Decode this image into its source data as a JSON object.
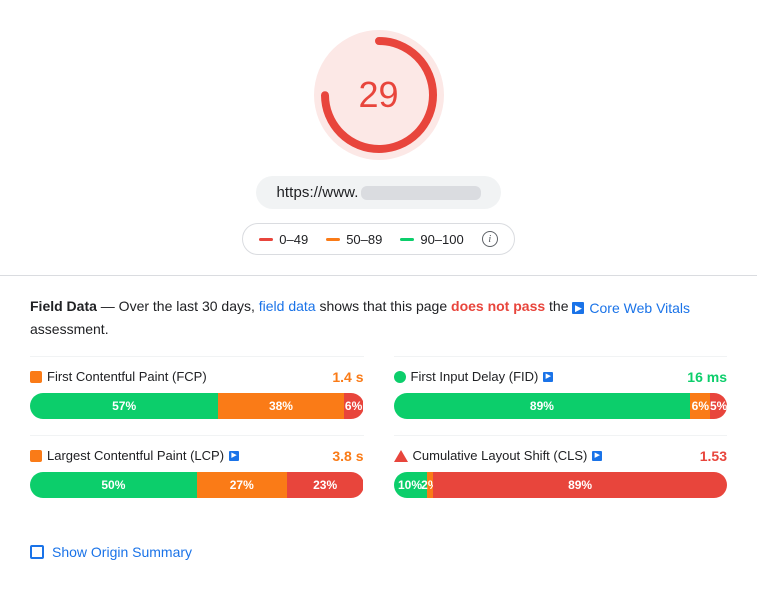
{
  "score": {
    "value": "29",
    "color": "#e8453c",
    "bg_color": "#fce8e6",
    "arc_percent": 29
  },
  "url": {
    "display": "https://www."
  },
  "legend": {
    "range1": "0–49",
    "range2": "50–89",
    "range3": "90–100"
  },
  "field_data": {
    "label": "Field Data",
    "description_prefix": "— Over the last 30 days,",
    "link_text": "field data",
    "description_mid": "shows that this page",
    "fail_text": "does not pass",
    "description_suffix": "the",
    "cwv_text": "Core Web Vitals",
    "assessment": "assessment."
  },
  "metrics": [
    {
      "id": "fcp",
      "icon_type": "orange-square",
      "title": "First Contentful Paint (FCP)",
      "has_flag": false,
      "value": "1.4 s",
      "value_color": "orange",
      "bars": [
        {
          "label": "57%",
          "pct": 57,
          "color": "green"
        },
        {
          "label": "38%",
          "pct": 38,
          "color": "orange"
        },
        {
          "label": "6%",
          "pct": 6,
          "color": "red"
        }
      ]
    },
    {
      "id": "fid",
      "icon_type": "green-circle",
      "title": "First Input Delay (FID)",
      "has_flag": true,
      "value": "16 ms",
      "value_color": "green",
      "bars": [
        {
          "label": "89%",
          "pct": 89,
          "color": "green"
        },
        {
          "label": "6%",
          "pct": 6,
          "color": "orange"
        },
        {
          "label": "5%",
          "pct": 5,
          "color": "red"
        }
      ]
    },
    {
      "id": "lcp",
      "icon_type": "orange-square",
      "title": "Largest Contentful Paint (LCP)",
      "has_flag": true,
      "value": "3.8 s",
      "value_color": "orange",
      "bars": [
        {
          "label": "50%",
          "pct": 50,
          "color": "green"
        },
        {
          "label": "27%",
          "pct": 27,
          "color": "orange"
        },
        {
          "label": "23%",
          "pct": 23,
          "color": "red"
        }
      ]
    },
    {
      "id": "cls",
      "icon_type": "red-triangle",
      "title": "Cumulative Layout Shift (CLS)",
      "has_flag": true,
      "value": "1.53",
      "value_color": "red",
      "bars": [
        {
          "label": "10%",
          "pct": 10,
          "color": "green"
        },
        {
          "label": "2%",
          "pct": 2,
          "color": "orange"
        },
        {
          "label": "89%",
          "pct": 89,
          "color": "red"
        }
      ]
    }
  ],
  "show_origin": {
    "label": "Show Origin Summary"
  }
}
